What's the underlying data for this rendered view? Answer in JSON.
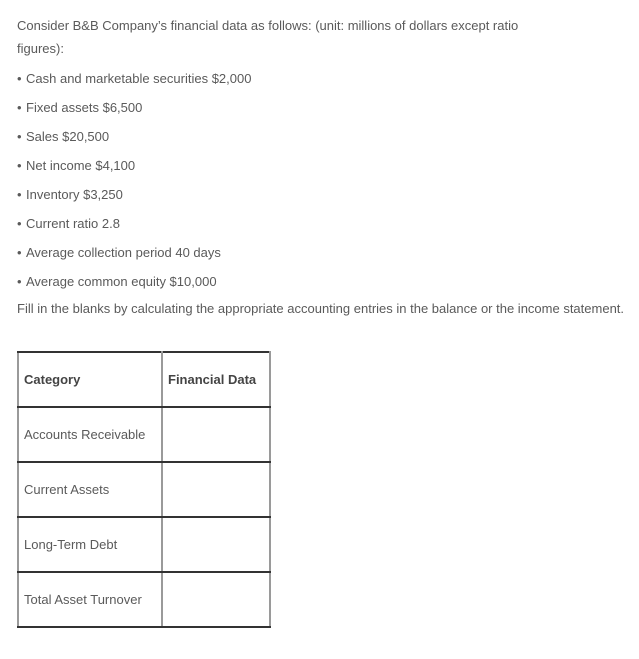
{
  "intro": "Consider B&B Company’s financial data as follows: (unit: millions of dollars except ratio figures):",
  "bullet_glyph": "•",
  "items": [
    "Cash and marketable securities $2,000",
    "Fixed assets $6,500",
    "Sales $20,500",
    "Net income $4,100",
    "Inventory $3,250",
    "Current ratio 2.8",
    "Average collection period 40 days",
    "Average common equity $10,000"
  ],
  "instruction": "Fill in the blanks by calculating the appropriate accounting entries in the balance or the income statement.",
  "table": {
    "headers": [
      "Category",
      "Financial Data"
    ],
    "rows": [
      {
        "category": "Accounts Receivable",
        "value": ""
      },
      {
        "category": "Current Assets",
        "value": ""
      },
      {
        "category": "Long-Term Debt",
        "value": ""
      },
      {
        "category": "Total Asset Turnover",
        "value": ""
      }
    ]
  }
}
